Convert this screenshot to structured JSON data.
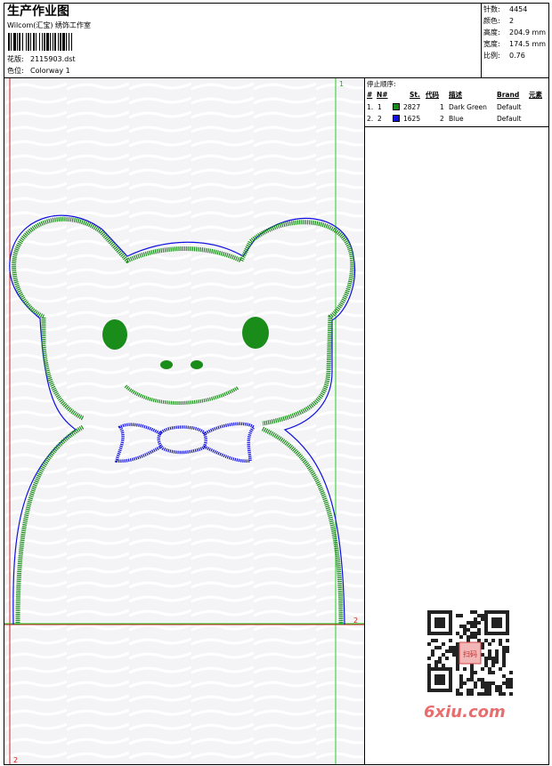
{
  "header": {
    "title": "生产作业图",
    "company": "Wilcom(汇宝) 绣饰工作室",
    "design_label": "花版:",
    "design_value": "2115903.dst",
    "colorway_label": "色位:",
    "colorway_value": "Colorway 1"
  },
  "stats": [
    {
      "label": "针数:",
      "value": "4454"
    },
    {
      "label": "颜色:",
      "value": "2"
    },
    {
      "label": "高度:",
      "value": "204.9 mm"
    },
    {
      "label": "宽度:",
      "value": "174.5 mm"
    },
    {
      "label": "比例:",
      "value": "0.76"
    }
  ],
  "stop_sequence": {
    "title": "停止顺序:",
    "columns": [
      "#",
      "N#",
      "St.",
      "代码",
      "描述",
      "Brand",
      "元素"
    ],
    "rows": [
      {
        "num": "1.",
        "n": "1",
        "color": "#1a8c1a",
        "st": "2827",
        "code": "1",
        "desc": "Dark Green",
        "brand": "Default"
      },
      {
        "num": "2.",
        "n": "2",
        "color": "#1010e0",
        "st": "1625",
        "code": "2",
        "desc": "Blue",
        "brand": "Default"
      }
    ]
  },
  "canvas": {
    "marker_top": "1",
    "marker_right": "2",
    "marker_bottom": "2",
    "colors": {
      "green": "#1a8c1a",
      "blue": "#1010e0",
      "red": "#cc2222",
      "guide": "#22cc22"
    }
  },
  "watermark": {
    "text": "6xiu.com",
    "qr_label": "扫码"
  }
}
